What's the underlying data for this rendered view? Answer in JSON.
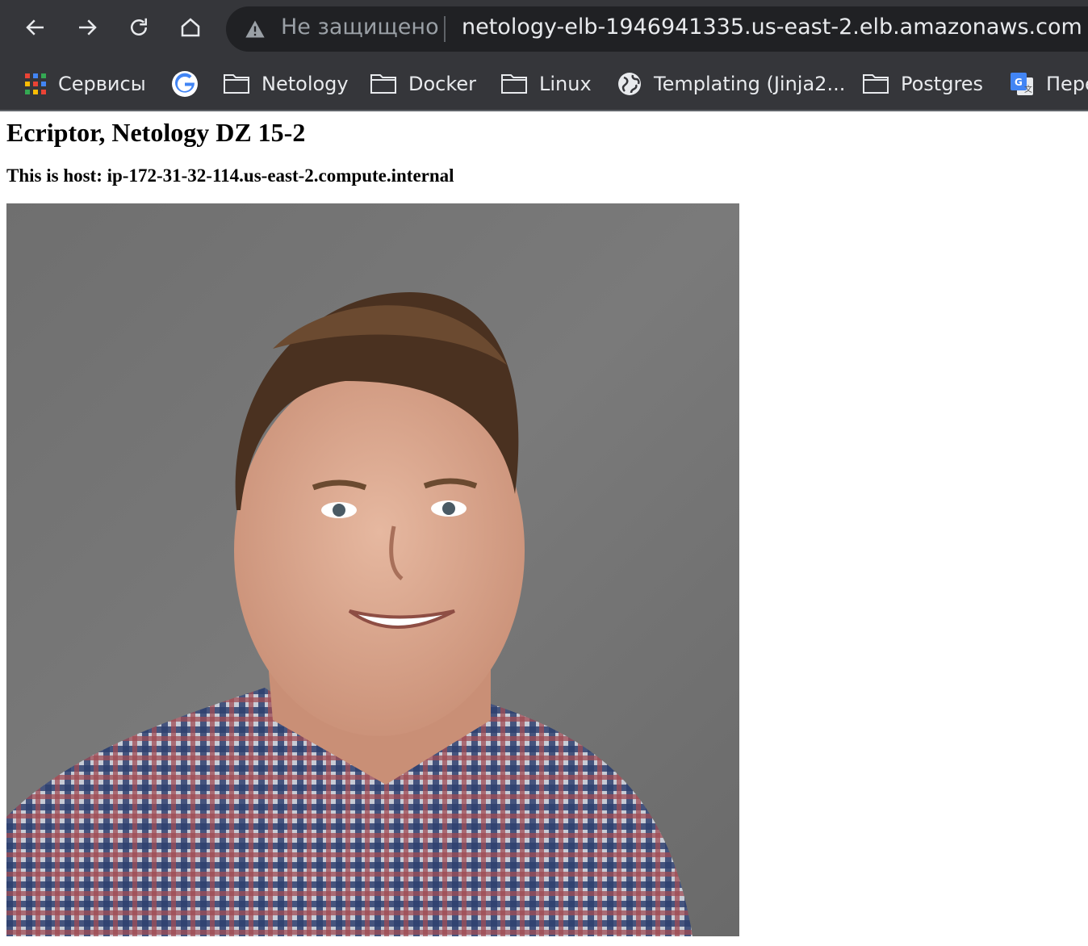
{
  "browser": {
    "security_label": "Не защищено",
    "url": "netology-elb-1946941335.us-east-2.elb.amazonaws.com",
    "bookmarks": [
      {
        "label": "Сервисы",
        "icon": "apps-grid-icon"
      },
      {
        "label": "",
        "icon": "google-icon"
      },
      {
        "label": "Netology",
        "icon": "folder-icon"
      },
      {
        "label": "Docker",
        "icon": "folder-icon"
      },
      {
        "label": "Linux",
        "icon": "folder-icon"
      },
      {
        "label": "Templating (Jinja2...",
        "icon": "globe-icon"
      },
      {
        "label": "Postgres",
        "icon": "folder-icon"
      },
      {
        "label": "Пере",
        "icon": "google-translate-icon"
      }
    ]
  },
  "page": {
    "title": "Ecriptor, Netology DZ 15-2",
    "host_line": "This is host: ip-172-31-32-114.us-east-2.compute.internal"
  },
  "colors": {
    "chrome_bg": "#35363a",
    "omnibox_bg": "#202124",
    "photo_bg": "#717171"
  }
}
